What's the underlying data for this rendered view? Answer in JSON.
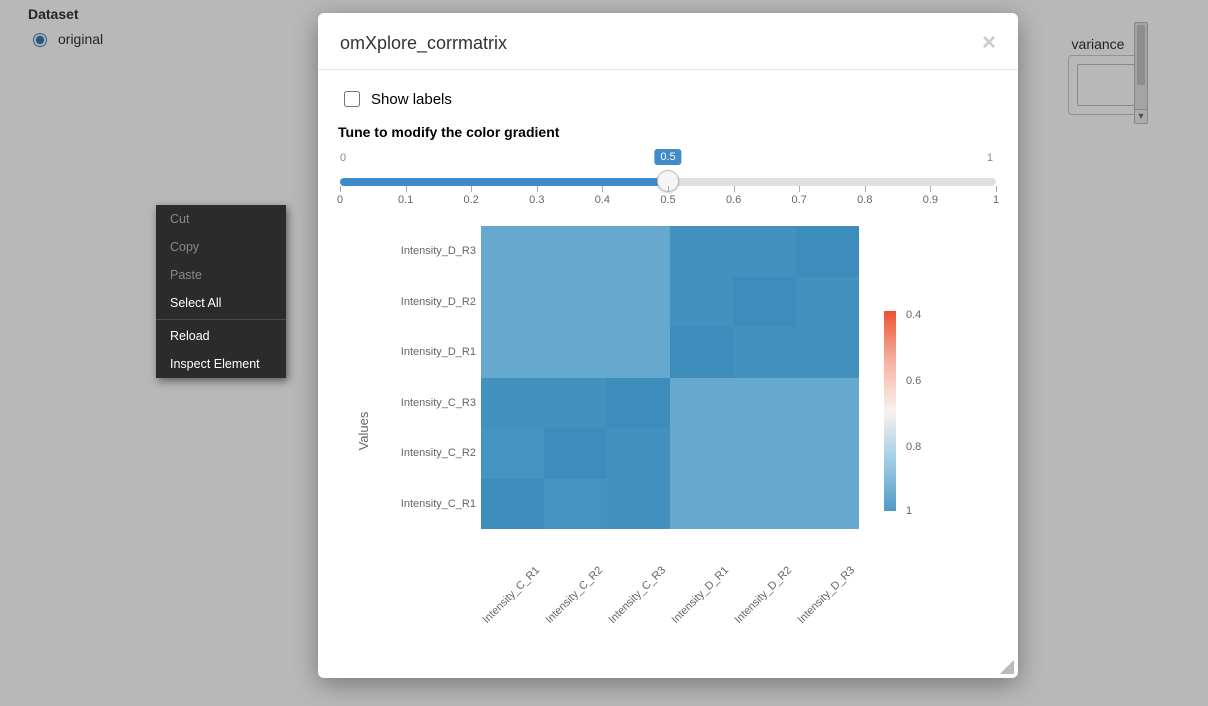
{
  "sidebar": {
    "title": "Dataset",
    "radio_label": "original"
  },
  "bg_right": {
    "tab_label": "variance"
  },
  "modal": {
    "title": "omXplore_corrmatrix",
    "show_labels_label": "Show labels",
    "slider_title": "Tune to modify the color gradient",
    "slider_min": "0",
    "slider_max": "1",
    "slider_value": "0.5",
    "slider_ticks": [
      "0",
      "0.1",
      "0.2",
      "0.3",
      "0.4",
      "0.5",
      "0.6",
      "0.7",
      "0.8",
      "0.9",
      "1"
    ]
  },
  "context_menu": {
    "cut": "Cut",
    "copy": "Copy",
    "paste": "Paste",
    "select_all": "Select All",
    "reload": "Reload",
    "inspect": "Inspect Element"
  },
  "chart_data": {
    "type": "heatmap",
    "title": "",
    "ylabel": "Values",
    "xlabel": "",
    "y_categories_top_to_bottom": [
      "Intensity_D_R3",
      "Intensity_D_R2",
      "Intensity_D_R1",
      "Intensity_C_R3",
      "Intensity_C_R2",
      "Intensity_C_R1"
    ],
    "x_categories": [
      "Intensity_C_R1",
      "Intensity_C_R2",
      "Intensity_C_R3",
      "Intensity_D_R1",
      "Intensity_D_R2",
      "Intensity_D_R3"
    ],
    "values_row_major_top_to_bottom": [
      [
        0.86,
        0.86,
        0.86,
        0.98,
        0.98,
        1.0
      ],
      [
        0.86,
        0.86,
        0.86,
        0.98,
        1.0,
        0.98
      ],
      [
        0.86,
        0.86,
        0.86,
        1.0,
        0.98,
        0.98
      ],
      [
        0.98,
        0.98,
        1.0,
        0.86,
        0.86,
        0.86
      ],
      [
        0.97,
        1.0,
        0.98,
        0.86,
        0.86,
        0.86
      ],
      [
        1.0,
        0.97,
        0.98,
        0.86,
        0.86,
        0.86
      ]
    ],
    "colorbar": {
      "ticks": [
        "0.4",
        "0.6",
        "0.8",
        "1"
      ],
      "positions_pct_from_top": [
        2,
        35,
        68,
        100
      ]
    }
  }
}
